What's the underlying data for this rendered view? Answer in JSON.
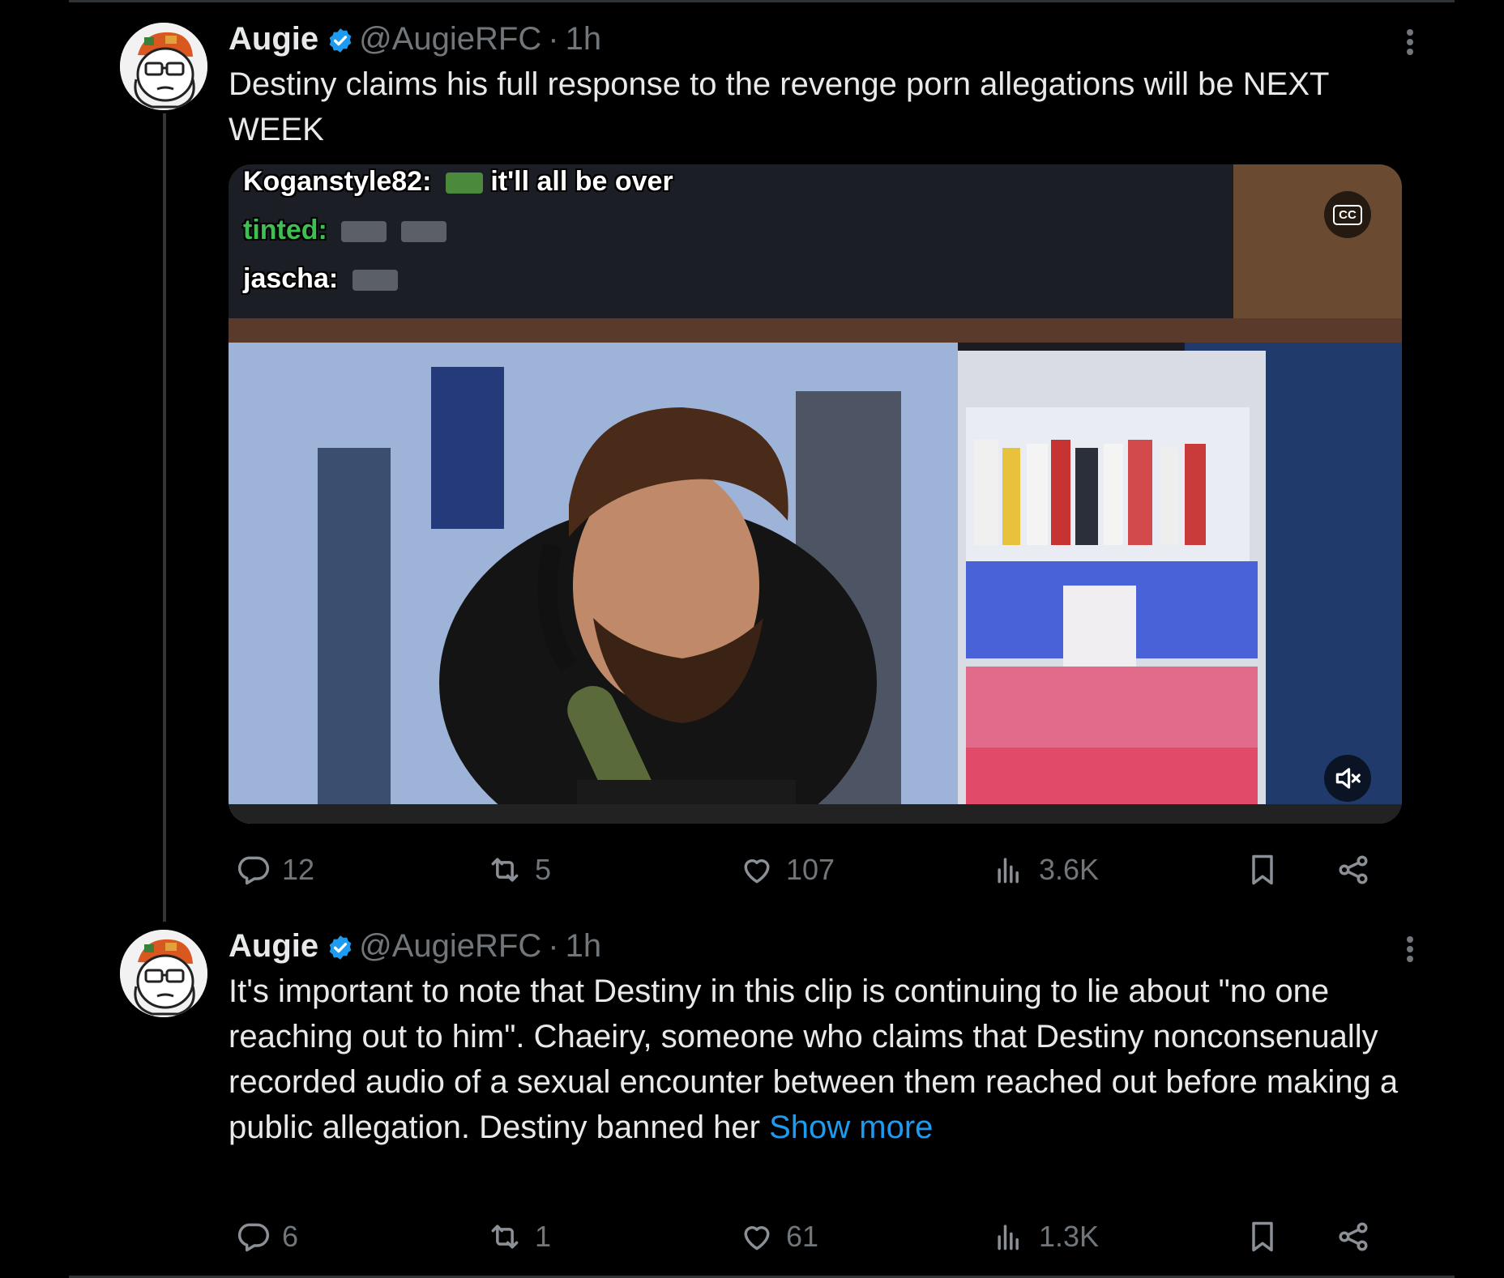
{
  "tweets": [
    {
      "name": "Augie",
      "handle": "@AugieRFC",
      "separator": "·",
      "time": "1h",
      "text": "Destiny claims his full response to the revenge porn allegations will be NEXT WEEK",
      "media": {
        "chat_lines": [
          {
            "user": "Koganstyle82:",
            "message": "it'll all be over"
          },
          {
            "user": "tinted:",
            "message": ""
          },
          {
            "user": "jascha:",
            "message": ""
          }
        ],
        "cc_label": "CC"
      },
      "stats": {
        "replies": "12",
        "reposts": "5",
        "likes": "107",
        "views": "3.6K"
      }
    },
    {
      "name": "Augie",
      "handle": "@AugieRFC",
      "separator": "·",
      "time": "1h",
      "text": "It's important to note that Destiny in this clip is continuing to lie about \"no one reaching out to him\". Chaeiry, someone who claims that Destiny nonconsenually recorded audio of a sexual encounter between them reached out before making a public allegation. Destiny banned her",
      "show_more": "Show more",
      "stats": {
        "replies": "6",
        "reposts": "1",
        "likes": "61",
        "views": "1.3K"
      }
    }
  ],
  "icons": {
    "verified": "verified-badge-icon",
    "more": "more-options-icon",
    "reply": "reply-icon",
    "repost": "repost-icon",
    "like": "like-icon",
    "views": "views-icon",
    "bookmark": "bookmark-icon",
    "share": "share-icon",
    "mute": "mute-icon"
  },
  "colors": {
    "background": "#000000",
    "text": "#e7e9ea",
    "secondary": "#71767b",
    "accent": "#1d9bf0"
  }
}
